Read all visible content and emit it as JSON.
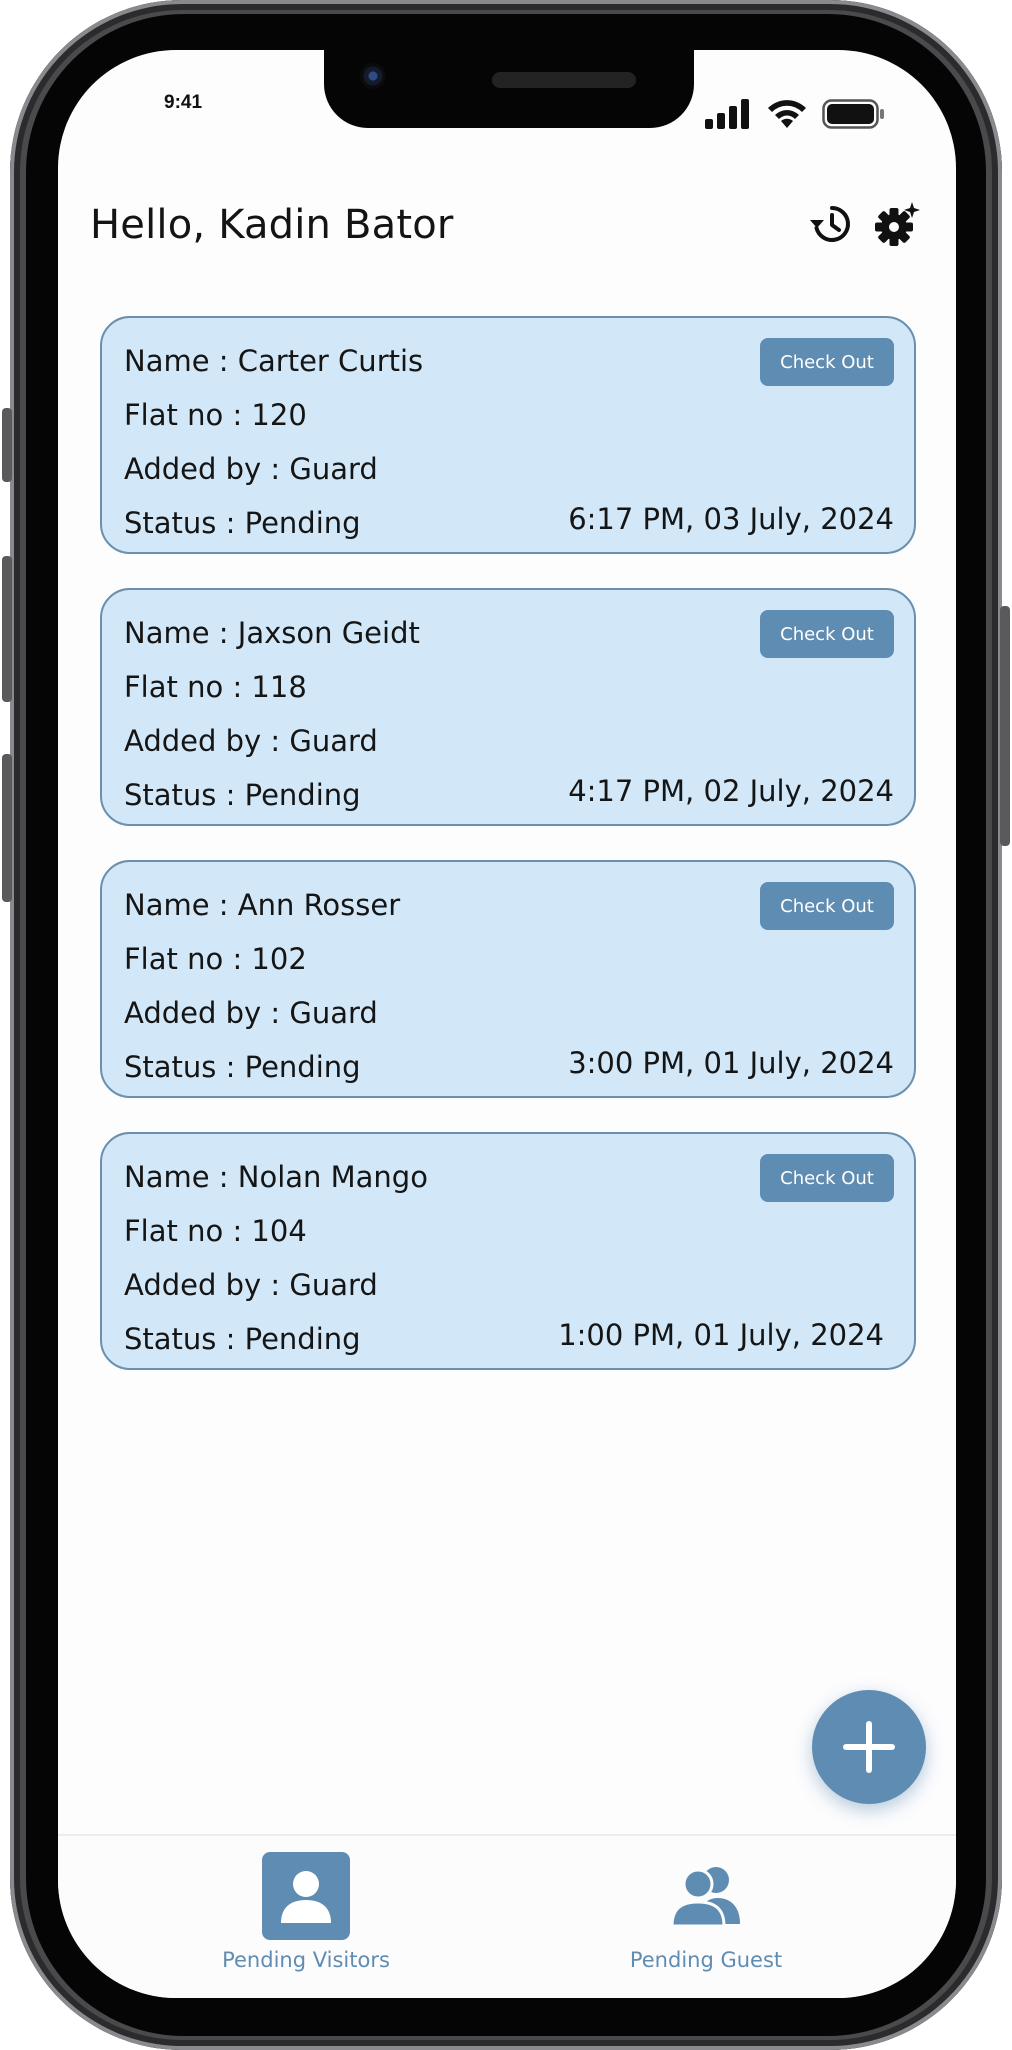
{
  "status_bar": {
    "time": "9:41"
  },
  "header": {
    "greeting": "Hello, Kadin Bator",
    "icons": [
      "history-icon",
      "settings-icon"
    ]
  },
  "visitors": [
    {
      "name": "Name : Carter Curtis",
      "flat": "Flat no : 120",
      "added_by": "Added by : Guard",
      "status": "Status : Pending",
      "timestamp": "6:17 PM, 03 July, 2024",
      "action_label": "Check Out"
    },
    {
      "name": "Name : Jaxson Geidt",
      "flat": "Flat no : 118",
      "added_by": "Added by : Guard",
      "status": "Status : Pending",
      "timestamp": "4:17 PM, 02 July, 2024",
      "action_label": "Check Out"
    },
    {
      "name": "Name : Ann Rosser",
      "flat": "Flat no : 102",
      "added_by": "Added by : Guard",
      "status": "Status : Pending",
      "timestamp": "3:00 PM, 01 July, 2024",
      "action_label": "Check Out"
    },
    {
      "name": "Name : Nolan Mango",
      "flat": "Flat no : 104",
      "added_by": "Added by : Guard",
      "status": "Status : Pending",
      "timestamp": "1:00 PM, 01 July, 2024",
      "action_label": "Check Out"
    }
  ],
  "fab": {
    "icon": "plus-icon"
  },
  "bottom_nav": {
    "items": [
      {
        "label": "Pending Visitors",
        "icon": "person-icon",
        "active": true
      },
      {
        "label": "Pending Guest",
        "icon": "people-icon",
        "active": false
      }
    ]
  },
  "colors": {
    "accent": "#5f8cb2",
    "card_bg": "#d2e8f8",
    "card_border": "#6b8fad",
    "text": "#151515"
  }
}
